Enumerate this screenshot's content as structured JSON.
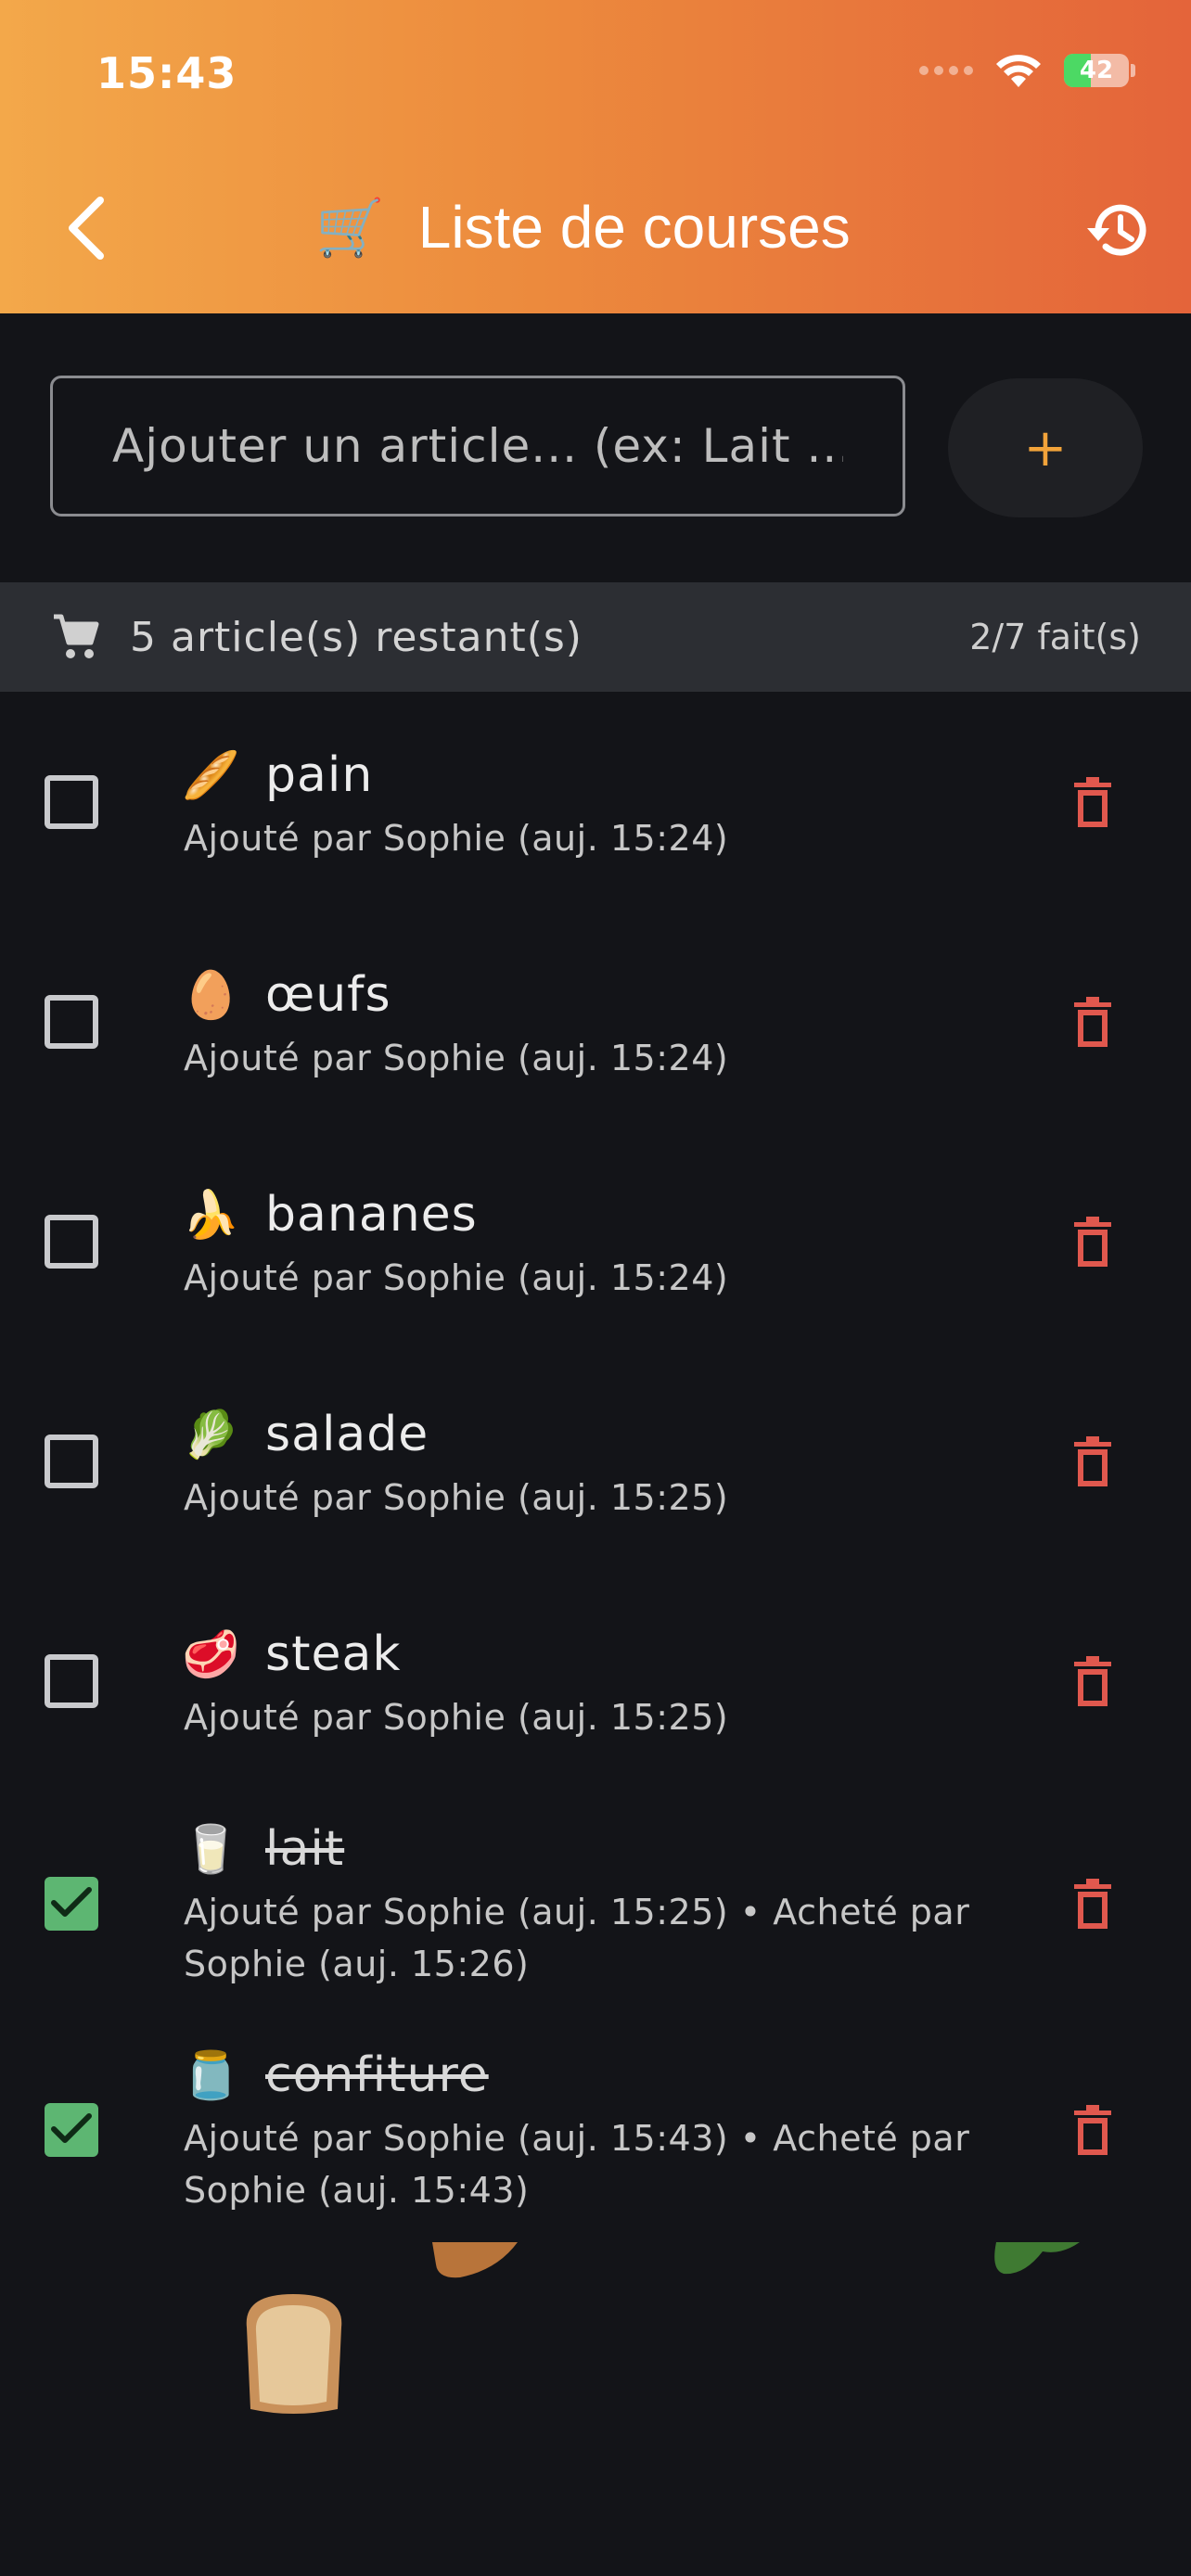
{
  "status_bar": {
    "time": "15:43",
    "battery": "42"
  },
  "header": {
    "title_emoji": "🛒",
    "title": "Liste de courses"
  },
  "add_item": {
    "placeholder": "Ajouter un article... (ex: Lait ...",
    "button_label": "+"
  },
  "summary": {
    "remaining": "5 article(s) restant(s)",
    "done": "2/7 fait(s)"
  },
  "items": [
    {
      "emoji": "🥖",
      "name": "pain",
      "meta": "Ajouté par Sophie (auj. 15:24)",
      "checked": false
    },
    {
      "emoji": "🥚",
      "name": "œufs",
      "meta": "Ajouté par Sophie (auj. 15:24)",
      "checked": false
    },
    {
      "emoji": "🍌",
      "name": "bananes",
      "meta": "Ajouté par Sophie (auj. 15:24)",
      "checked": false
    },
    {
      "emoji": "🥬",
      "name": "salade",
      "meta": "Ajouté par Sophie (auj. 15:25)",
      "checked": false
    },
    {
      "emoji": "🥩",
      "name": "steak",
      "meta": "Ajouté par Sophie (auj. 15:25)",
      "checked": false
    },
    {
      "emoji": "🥛",
      "name": "lait",
      "meta": "Ajouté par Sophie (auj. 15:25) • Acheté par Sophie (auj. 15:26)",
      "checked": true
    },
    {
      "emoji": "🫙",
      "name": "confiture",
      "meta": "Ajouté par Sophie (auj. 15:43) • Acheté par Sophie (auj. 15:43)",
      "checked": true
    }
  ],
  "colors": {
    "accent": "#f2a33a",
    "delete": "#e0584e",
    "checked": "#5db672",
    "header_start": "#f3a84a",
    "header_end": "#e4643a"
  }
}
